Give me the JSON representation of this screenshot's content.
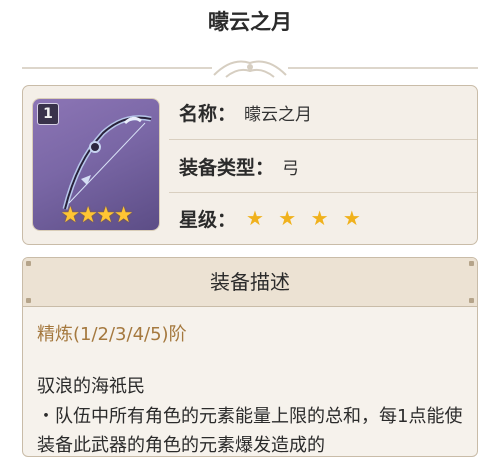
{
  "page": {
    "title": "曚云之月"
  },
  "weapon": {
    "refine_level": "1",
    "frame_stars": "★★★★",
    "fields": {
      "name_label": "名称：",
      "name_value": "曚云之月",
      "type_label": "装备类型：",
      "type_value": "弓",
      "rarity_label": "星级：",
      "rarity_stars": "★ ★ ★ ★"
    },
    "rarity": 4
  },
  "description": {
    "header": "装备描述",
    "refinement": "精炼(1/2/3/4/5)阶",
    "passive_name": "驭浪的海祇民",
    "passive_text": "・队伍中所有角色的元素能量上限的总和，每1点能使装备此武器的角色的元素爆发造成的"
  },
  "colors": {
    "accent_gold": "#a5793f",
    "star": "#f0b11c",
    "panel_border": "#c9bca8",
    "panel_bg": "#f4efe8",
    "weapon_bg": "#7a67a6"
  }
}
